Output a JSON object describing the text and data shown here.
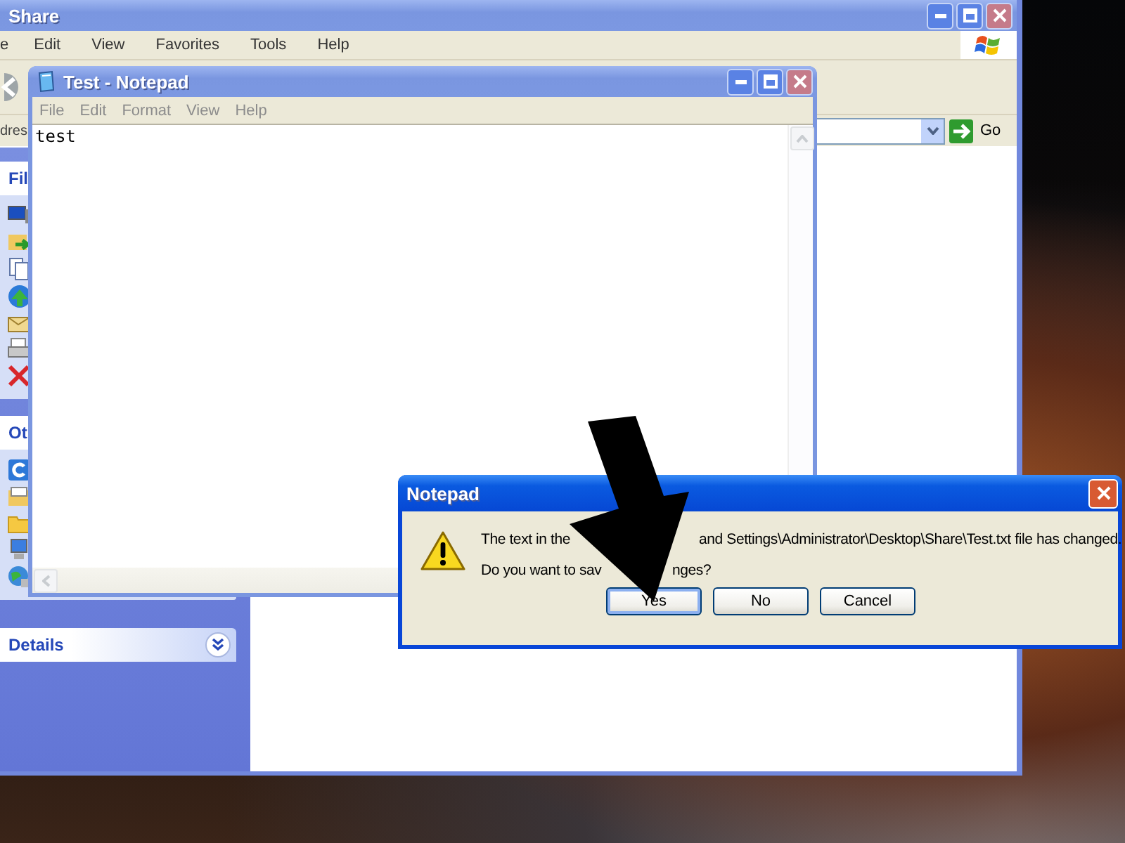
{
  "explorer": {
    "title": "Share",
    "menu": [
      "e",
      "Edit",
      "View",
      "Favorites",
      "Tools",
      "Help"
    ],
    "address_label": "dres",
    "go_label": "Go",
    "panels": [
      {
        "title": "Fil",
        "kind": "tasks"
      },
      {
        "title": "Ot",
        "kind": "places"
      },
      {
        "title": "Details",
        "kind": "details"
      }
    ]
  },
  "notepad": {
    "title": "Test - Notepad",
    "menu": [
      "File",
      "Edit",
      "Format",
      "View",
      "Help"
    ],
    "content": "test"
  },
  "dialog": {
    "title": "Notepad",
    "message_line_1": [
      "The text in the",
      "and Settings\\Administrator\\Desktop\\Share\\Test.txt file has changed."
    ],
    "message_line_2": [
      "Do you want to sav",
      "nges?"
    ],
    "buttons": [
      {
        "label": "Yes",
        "focused": true
      },
      {
        "label": "No",
        "focused": false
      },
      {
        "label": "Cancel",
        "focused": false
      }
    ]
  }
}
